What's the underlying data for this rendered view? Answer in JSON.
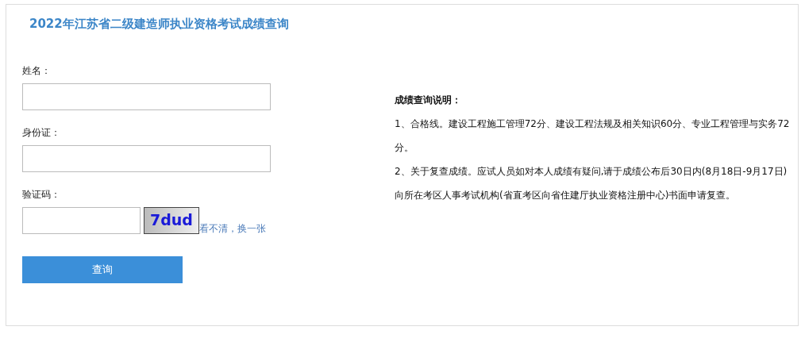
{
  "title": "2022年江苏省二级建造师执业资格考试成绩查询",
  "form": {
    "fields": [
      {
        "label": "姓名："
      },
      {
        "label": "身份证："
      }
    ],
    "captcha": {
      "label": "验证码：",
      "image_text": "7dud",
      "refresh_link": "看不清，换一张"
    },
    "submit": "查询"
  },
  "notes": {
    "heading": "成绩查询说明：",
    "paragraphs": [
      "1、合格线。建设工程施工管理72分、建设工程法规及相关知识60分、专业工程管理与实务72分。",
      "2、关于复查成绩。应试人员如对本人成绩有疑问,请于成绩公布后30日内(8月18日-9月17日)向所在考区人事考试机构(省直考区向省住建厅执业资格注册中心)书面申请复查。"
    ]
  }
}
